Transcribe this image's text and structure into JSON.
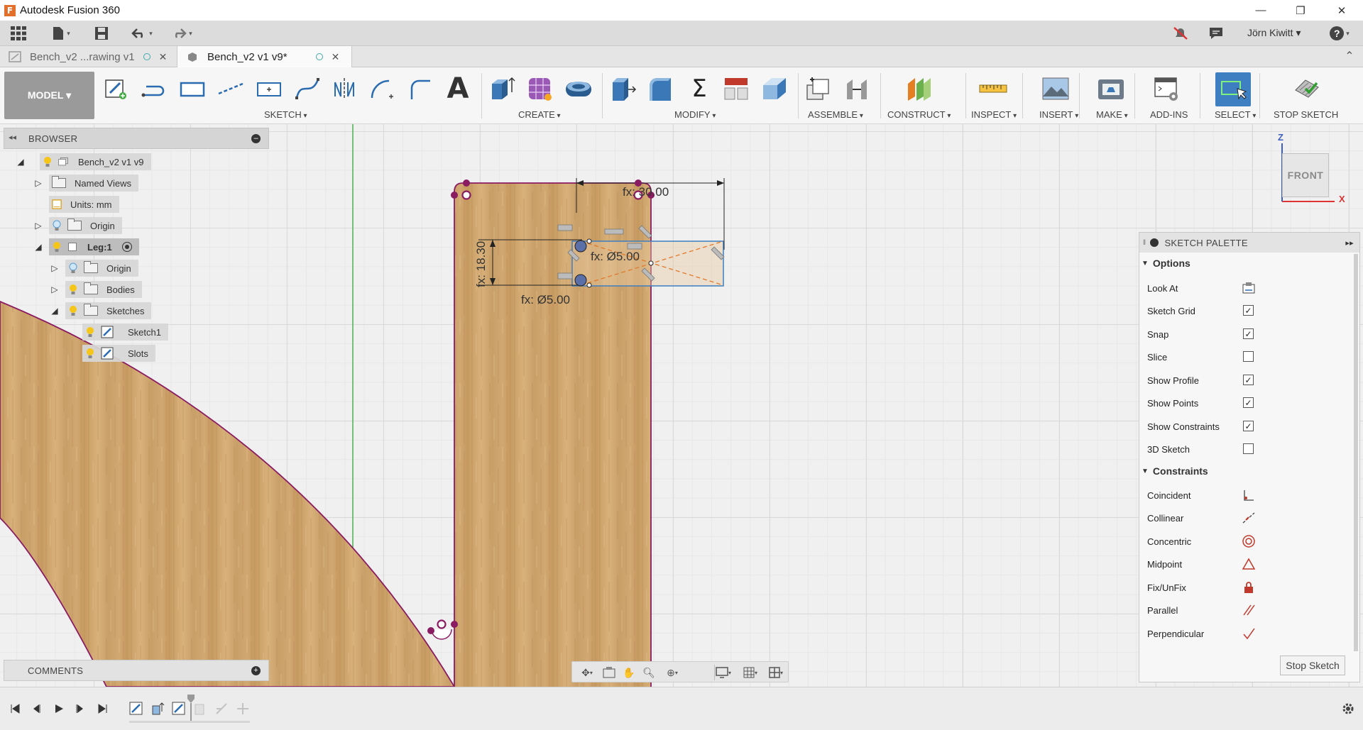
{
  "window": {
    "title": "Autodesk Fusion 360",
    "app_icon": "F",
    "colors": {
      "accent": "#3d7fc1",
      "sketch_line": "#8a1c62",
      "wood": "#c9a46f"
    }
  },
  "appbar": {
    "user": "Jörn Kiwitt ▾",
    "help": "?"
  },
  "tabs": [
    {
      "label": "Bench_v2 ...rawing v1",
      "active": false
    },
    {
      "label": "Bench_v2 v1 v9*",
      "active": true
    }
  ],
  "toolbar": {
    "workspace": "MODEL ▾",
    "groups": [
      "SKETCH",
      "CREATE",
      "MODIFY",
      "ASSEMBLE",
      "CONSTRUCT",
      "INSPECT",
      "INSERT",
      "MAKE",
      "ADD-INS",
      "SELECT",
      "STOP SKETCH"
    ]
  },
  "browser": {
    "title": "BROWSER",
    "items": [
      {
        "label": "Bench_v2 v1 v9",
        "icon": "bulb-icon",
        "kind": "root"
      },
      {
        "label": "Named Views"
      },
      {
        "label": "Units: mm"
      },
      {
        "label": "Origin"
      },
      {
        "label": "Leg:1"
      },
      {
        "label": "Origin"
      },
      {
        "label": "Bodies"
      },
      {
        "label": "Sketches"
      },
      {
        "label": "Sketch1"
      },
      {
        "label": "Slots"
      }
    ]
  },
  "comments": {
    "title": "COMMENTS"
  },
  "viewcube": {
    "face": "FRONT",
    "z": "Z",
    "x": "X"
  },
  "dimensions": {
    "top_width": "fx: 30.00",
    "height": "fx: 18.30",
    "dia_right": "fx: Ø5.00",
    "dia_bottom": "fx: Ø5.00"
  },
  "palette": {
    "title": "SKETCH PALETTE",
    "options_title": "Options",
    "options": [
      {
        "label": "Look At",
        "type": "icon"
      },
      {
        "label": "Sketch Grid",
        "checked": true
      },
      {
        "label": "Snap",
        "checked": true
      },
      {
        "label": "Slice",
        "checked": false
      },
      {
        "label": "Show Profile",
        "checked": true
      },
      {
        "label": "Show Points",
        "checked": true
      },
      {
        "label": "Show Constraints",
        "checked": true
      },
      {
        "label": "3D Sketch",
        "checked": false
      }
    ],
    "constraints_title": "Constraints",
    "constraints": [
      {
        "label": "Coincident",
        "icon": "coincident-icon"
      },
      {
        "label": "Collinear",
        "icon": "collinear-icon"
      },
      {
        "label": "Concentric",
        "icon": "concentric-icon"
      },
      {
        "label": "Midpoint",
        "icon": "midpoint-icon"
      },
      {
        "label": "Fix/UnFix",
        "icon": "lock-icon"
      },
      {
        "label": "Parallel",
        "icon": "parallel-icon"
      },
      {
        "label": "Perpendicular",
        "icon": "perpendicular-icon"
      }
    ],
    "stop_button": "Stop Sketch"
  }
}
